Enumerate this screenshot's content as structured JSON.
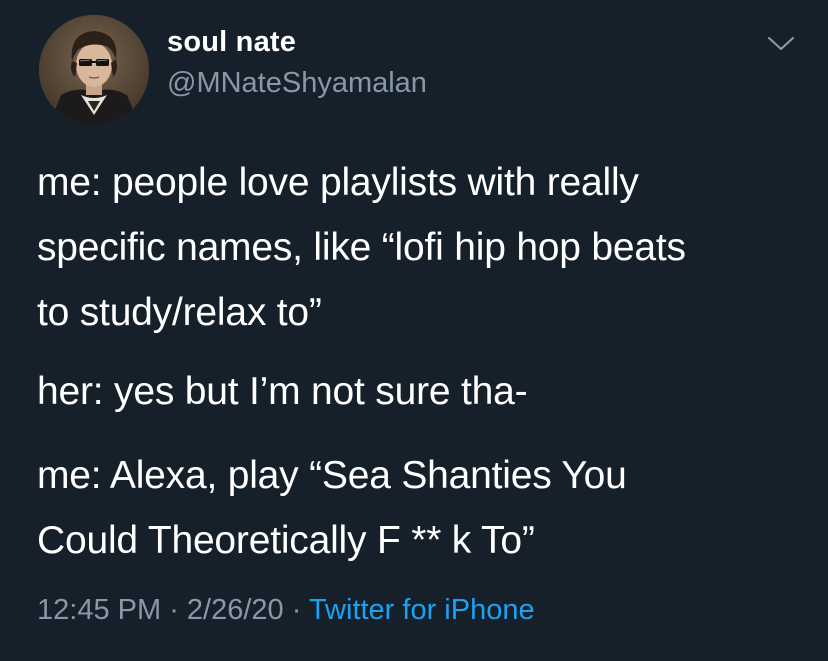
{
  "user": {
    "display_name": "soul nate",
    "handle": "@MNateShyamalan"
  },
  "tweet": {
    "paragraph1": [
      "me: people love playlists with really",
      "specific names, like “lofi hip hop beats",
      "to study/relax to”"
    ],
    "paragraph2": [
      "her: yes but I’m not sure tha-"
    ],
    "paragraph3": [
      "me: Alexa, play “Sea Shanties You",
      "Could Theoretically F ** k To”"
    ]
  },
  "meta": {
    "time": "12:45 PM",
    "separator1": " · ",
    "date": "2/26/20",
    "separator2": " · ",
    "source": "Twitter for iPhone"
  },
  "icons": {
    "chevron": "chevron-down-icon",
    "avatar": "avatar"
  },
  "colors": {
    "background": "#15202b",
    "text": "#ffffff",
    "secondary": "#8899a6",
    "link": "#1da1f2"
  }
}
